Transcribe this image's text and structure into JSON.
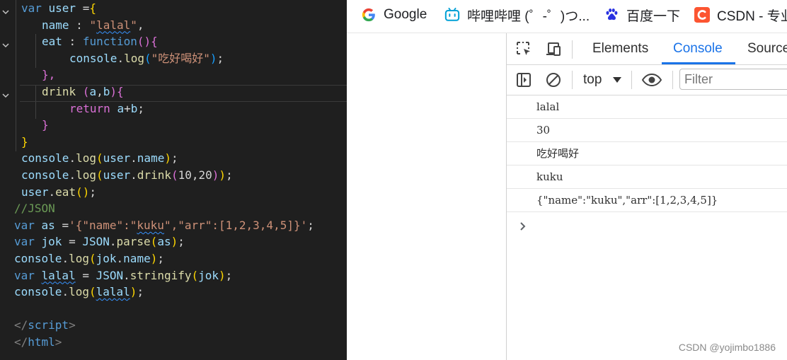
{
  "editor": {
    "lines": [
      [
        {
          "t": "var ",
          "c": "k"
        },
        {
          "t": "user ",
          "c": "v"
        },
        {
          "t": "=",
          "c": "p"
        },
        {
          "t": "{",
          "c": "b1"
        }
      ],
      [
        {
          "t": "name",
          "c": "v"
        },
        {
          "t": " : ",
          "c": "p"
        },
        {
          "t": "\"",
          "c": "s"
        },
        {
          "t": "lalal",
          "c": "s",
          "sq": true
        },
        {
          "t": "\"",
          "c": "s"
        },
        {
          "t": ",",
          "c": "p"
        }
      ],
      [
        {
          "t": "eat",
          "c": "v"
        },
        {
          "t": " : ",
          "c": "p"
        },
        {
          "t": "function",
          "c": "k"
        },
        {
          "t": "()",
          "c": "b2"
        },
        {
          "t": "{",
          "c": "b2"
        }
      ],
      [
        {
          "t": "console",
          "c": "v"
        },
        {
          "t": ".",
          "c": "p"
        },
        {
          "t": "log",
          "c": "f"
        },
        {
          "t": "(",
          "c": "b3"
        },
        {
          "t": "\"吃好喝好\"",
          "c": "s"
        },
        {
          "t": ")",
          "c": "b3"
        },
        {
          "t": ";",
          "c": "p"
        }
      ],
      [
        {
          "t": "},",
          "c": "b2"
        }
      ],
      [
        {
          "t": "drink ",
          "c": "f"
        },
        {
          "t": "(",
          "c": "b2"
        },
        {
          "t": "a",
          "c": "v"
        },
        {
          "t": ",",
          "c": "p"
        },
        {
          "t": "b",
          "c": "v"
        },
        {
          "t": ")",
          "c": "b2"
        },
        {
          "t": "{",
          "c": "b2"
        }
      ],
      [
        {
          "t": "return ",
          "c": "b2"
        },
        {
          "t": "a",
          "c": "v"
        },
        {
          "t": "+",
          "c": "p"
        },
        {
          "t": "b",
          "c": "v"
        },
        {
          "t": ";",
          "c": "p"
        }
      ],
      [
        {
          "t": "}",
          "c": "b2"
        }
      ],
      [
        {
          "t": "}",
          "c": "b1"
        }
      ],
      [
        {
          "t": "console",
          "c": "v"
        },
        {
          "t": ".",
          "c": "p"
        },
        {
          "t": "log",
          "c": "f"
        },
        {
          "t": "(",
          "c": "b1"
        },
        {
          "t": "user",
          "c": "v"
        },
        {
          "t": ".",
          "c": "p"
        },
        {
          "t": "name",
          "c": "v"
        },
        {
          "t": ")",
          "c": "b1"
        },
        {
          "t": ";",
          "c": "p"
        }
      ],
      [
        {
          "t": "console",
          "c": "v"
        },
        {
          "t": ".",
          "c": "p"
        },
        {
          "t": "log",
          "c": "f"
        },
        {
          "t": "(",
          "c": "b1"
        },
        {
          "t": "user",
          "c": "v"
        },
        {
          "t": ".",
          "c": "p"
        },
        {
          "t": "drink",
          "c": "f"
        },
        {
          "t": "(",
          "c": "b2"
        },
        {
          "t": "10",
          "c": "p"
        },
        {
          "t": ",",
          "c": "p"
        },
        {
          "t": "20",
          "c": "p"
        },
        {
          "t": ")",
          "c": "b2"
        },
        {
          "t": ")",
          "c": "b1"
        },
        {
          "t": ";",
          "c": "p"
        }
      ],
      [
        {
          "t": "user",
          "c": "v"
        },
        {
          "t": ".",
          "c": "p"
        },
        {
          "t": "eat",
          "c": "f"
        },
        {
          "t": "()",
          "c": "b1"
        },
        {
          "t": ";",
          "c": "p"
        }
      ],
      [
        {
          "t": "//JSON",
          "c": "c"
        }
      ],
      [
        {
          "t": "var ",
          "c": "k"
        },
        {
          "t": "as ",
          "c": "v"
        },
        {
          "t": "=",
          "c": "p"
        },
        {
          "t": "'{\"name\":\"",
          "c": "s"
        },
        {
          "t": "kuku",
          "c": "s",
          "sq": true
        },
        {
          "t": "\",\"arr\":[1,2,3,4,5]}'",
          "c": "s"
        },
        {
          "t": ";",
          "c": "p"
        }
      ],
      [
        {
          "t": "var ",
          "c": "k"
        },
        {
          "t": "jok ",
          "c": "v"
        },
        {
          "t": "= ",
          "c": "p"
        },
        {
          "t": "JSON",
          "c": "v"
        },
        {
          "t": ".",
          "c": "p"
        },
        {
          "t": "parse",
          "c": "f"
        },
        {
          "t": "(",
          "c": "b1"
        },
        {
          "t": "as",
          "c": "v"
        },
        {
          "t": ")",
          "c": "b1"
        },
        {
          "t": ";",
          "c": "p"
        }
      ],
      [
        {
          "t": "console",
          "c": "v"
        },
        {
          "t": ".",
          "c": "p"
        },
        {
          "t": "log",
          "c": "f"
        },
        {
          "t": "(",
          "c": "b1"
        },
        {
          "t": "jok",
          "c": "v"
        },
        {
          "t": ".",
          "c": "p"
        },
        {
          "t": "name",
          "c": "v"
        },
        {
          "t": ")",
          "c": "b1"
        },
        {
          "t": ";",
          "c": "p"
        }
      ],
      [
        {
          "t": "var ",
          "c": "k"
        },
        {
          "t": "lalal",
          "c": "v",
          "sq": true
        },
        {
          "t": " = ",
          "c": "p"
        },
        {
          "t": "JSON",
          "c": "v"
        },
        {
          "t": ".",
          "c": "p"
        },
        {
          "t": "stringify",
          "c": "f"
        },
        {
          "t": "(",
          "c": "b1"
        },
        {
          "t": "jok",
          "c": "v"
        },
        {
          "t": ")",
          "c": "b1"
        },
        {
          "t": ";",
          "c": "p"
        }
      ],
      [
        {
          "t": "console",
          "c": "v"
        },
        {
          "t": ".",
          "c": "p"
        },
        {
          "t": "log",
          "c": "f"
        },
        {
          "t": "(",
          "c": "b1"
        },
        {
          "t": "lalal",
          "c": "v",
          "sq": true
        },
        {
          "t": ")",
          "c": "b1"
        },
        {
          "t": ";",
          "c": "p"
        }
      ],
      [],
      [
        {
          "t": "</",
          "c": "tag"
        },
        {
          "t": "script",
          "c": "tg"
        },
        {
          "t": ">",
          "c": "tag"
        }
      ],
      [
        {
          "t": "</",
          "c": "tag"
        },
        {
          "t": "html",
          "c": "tg"
        },
        {
          "t": ">",
          "c": "tag"
        }
      ]
    ],
    "fold_icon": "chevron-down-icon"
  },
  "bookmarks": [
    {
      "label": "Google",
      "icon": "google-icon"
    },
    {
      "label": "哔哩哔哩 (゜-゜)つ...",
      "icon": "bilibili-icon"
    },
    {
      "label": "百度一下",
      "icon": "baidu-paw-icon"
    },
    {
      "label": "CSDN - 专业",
      "icon": "csdn-icon"
    }
  ],
  "devtools": {
    "tabs": [
      {
        "label": "Elements",
        "active": false
      },
      {
        "label": "Console",
        "active": true
      },
      {
        "label": "Sources",
        "active": false
      }
    ],
    "toolbar": {
      "context": "top",
      "filter_placeholder": "Filter"
    },
    "console_messages": [
      "lalal",
      "30",
      "吃好喝好",
      "kuku",
      "{\"name\":\"kuku\",\"arr\":[1,2,3,4,5]}"
    ],
    "accent_color": "#1a73e8"
  },
  "watermark": "CSDN @yojimbo1886"
}
